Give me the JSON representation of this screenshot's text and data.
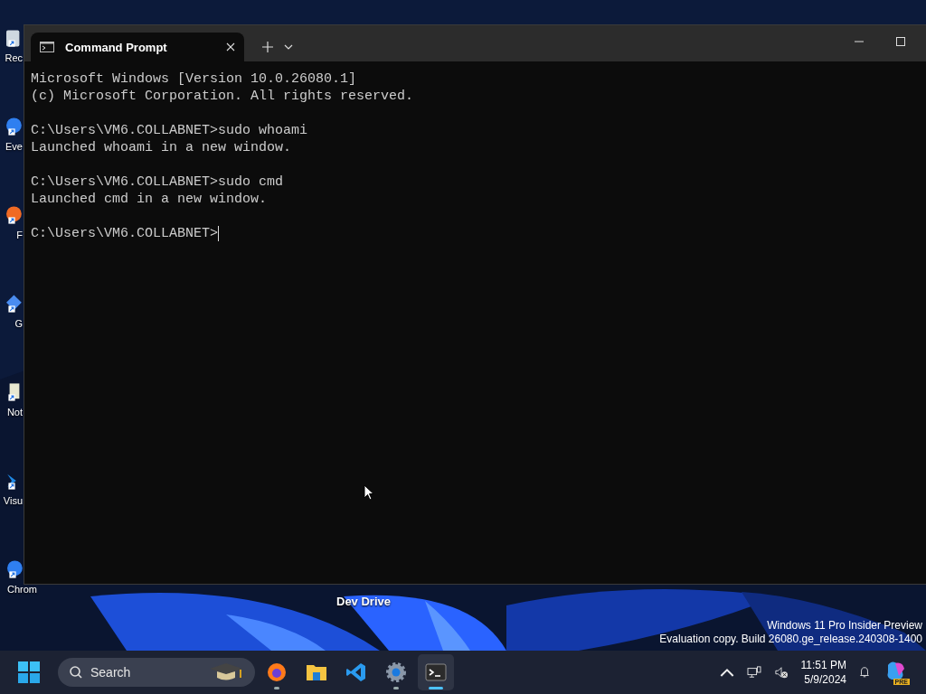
{
  "desktop": {
    "icons": [
      {
        "label": "Rec",
        "kind": "bin"
      },
      {
        "label": "Eve",
        "kind": "orb"
      },
      {
        "label": "F",
        "kind": "fox"
      },
      {
        "label": "G",
        "kind": "diamond"
      },
      {
        "label": "Not",
        "kind": "pad"
      },
      {
        "label": "Visu",
        "kind": "vs"
      },
      {
        "label": "Chrom",
        "kind": "orb"
      }
    ],
    "drive_label": "Dev Drive",
    "watermark_lines": [
      "Windows 11 Pro Insider Preview",
      "Evaluation copy. Build 26080.ge_release.240308-1400"
    ]
  },
  "window": {
    "tabs": [
      {
        "title": "Command Prompt",
        "selected": true
      }
    ],
    "terminal": {
      "blocks": [
        [
          "Microsoft Windows [Version 10.0.26080.1]",
          "(c) Microsoft Corporation. All rights reserved."
        ],
        [
          "C:\\Users\\VM6.COLLABNET>sudo whoami",
          "Launched whoami in a new window."
        ],
        [
          "C:\\Users\\VM6.COLLABNET>sudo cmd",
          "Launched cmd in a new window."
        ]
      ],
      "prompt": "C:\\Users\\VM6.COLLABNET>"
    }
  },
  "taskbar": {
    "search": {
      "placeholder": "Search"
    },
    "apps": [
      {
        "kind": "firefox",
        "running": true,
        "selected": false
      },
      {
        "kind": "folder",
        "running": false,
        "selected": false
      },
      {
        "kind": "vscode",
        "running": false,
        "selected": false
      },
      {
        "kind": "settings",
        "running": true,
        "selected": false
      },
      {
        "kind": "terminal",
        "running": true,
        "selected": true
      }
    ],
    "time": "11:51 PM",
    "date": "5/9/2024",
    "copilot_badge": "PRE"
  }
}
